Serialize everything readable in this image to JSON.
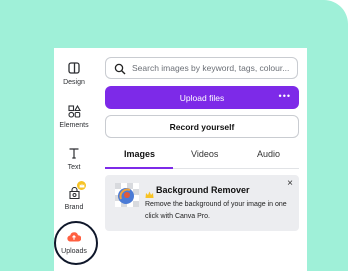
{
  "sidebar": {
    "items": [
      {
        "label": "Design",
        "icon": "layout-icon"
      },
      {
        "label": "Elements",
        "icon": "shapes-icon"
      },
      {
        "label": "Text",
        "icon": "text-icon"
      },
      {
        "label": "Brand",
        "icon": "brand-icon"
      },
      {
        "label": "Uploads",
        "icon": "upload-cloud-icon"
      }
    ]
  },
  "search": {
    "placeholder": "Search images by keyword, tags, colour..."
  },
  "actions": {
    "upload_label": "Upload files",
    "more_label": "•••",
    "record_label": "Record yourself"
  },
  "tabs": [
    {
      "label": "Images"
    },
    {
      "label": "Videos"
    },
    {
      "label": "Audio"
    }
  ],
  "promo": {
    "title": "Background Remover",
    "description": "Remove the background of your image in one click with Canva Pro.",
    "close_label": "×"
  },
  "colors": {
    "accent": "#7d2ae8",
    "background": "#9ff0d8",
    "badge": "#f7c325",
    "upload_icon": "#ff5f40"
  }
}
